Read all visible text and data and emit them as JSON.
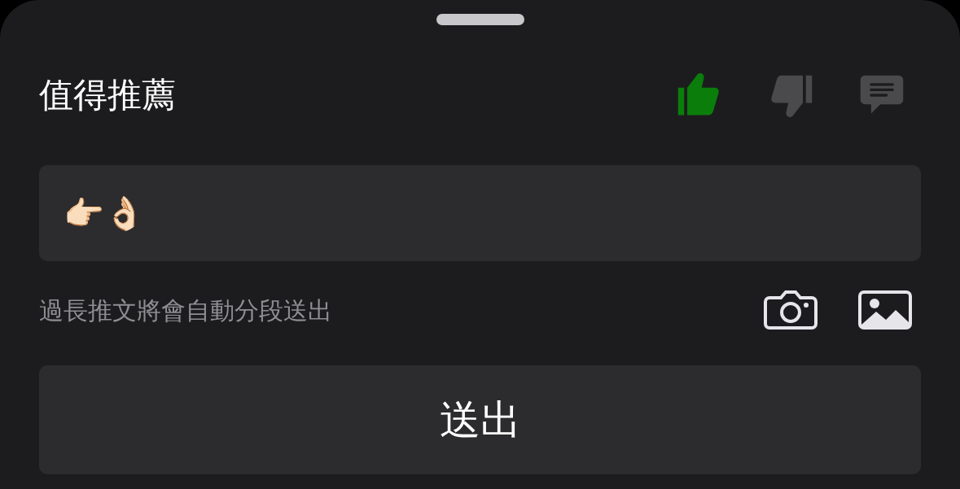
{
  "title": "值得推薦",
  "reactions": [
    {
      "kind": "like",
      "selected": true
    },
    {
      "kind": "dislike",
      "selected": false
    },
    {
      "kind": "comment",
      "selected": false
    }
  ],
  "input": {
    "value": "👉🏻👌🏻"
  },
  "hint": "過長推文將會自動分段送出",
  "attachments": [
    {
      "kind": "camera"
    },
    {
      "kind": "image"
    }
  ],
  "submit": "送出"
}
